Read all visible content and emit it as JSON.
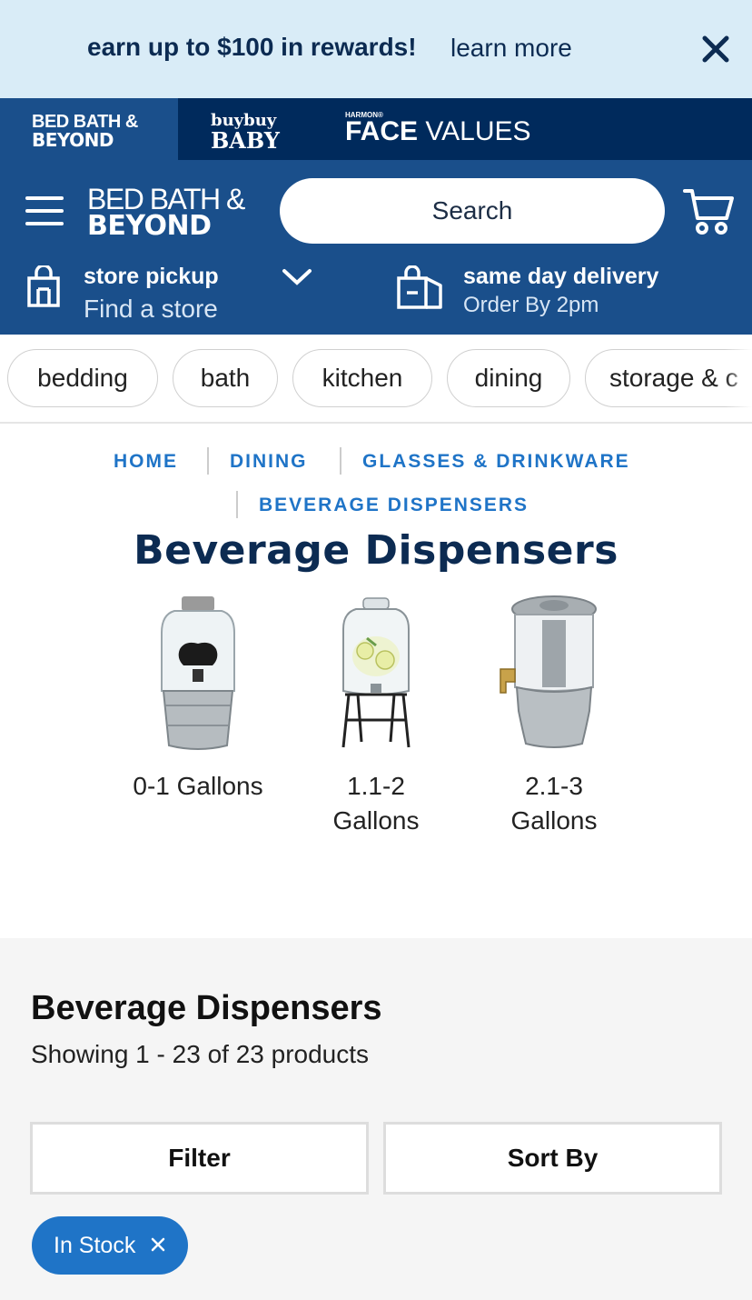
{
  "promo": {
    "text": "earn up to $100 in rewards!",
    "link": "learn more"
  },
  "brands": {
    "bbb_line1": "BED BATH &",
    "bbb_line2": "BEYOND",
    "buybuy_line1": "buybuy",
    "buybuy_line2": "BABY",
    "harmon": "HARMON®",
    "face": "FACE",
    "values": "VALUES"
  },
  "header": {
    "logo_line1": "BED BATH &",
    "logo_line2": "BEYOND",
    "search_placeholder": "Search",
    "pickup_title": "store pickup",
    "pickup_sub": "Find a store",
    "delivery_title": "same day delivery",
    "delivery_sub": "Order By 2pm"
  },
  "categories": [
    "bedding",
    "bath",
    "kitchen",
    "dining",
    "storage & c"
  ],
  "breadcrumb": [
    "HOME",
    "DINING",
    "GLASSES & DRINKWARE",
    "BEVERAGE DISPENSERS"
  ],
  "page_title": "Beverage Dispensers",
  "subcategories": [
    {
      "line1": "0-1 Gallons",
      "line2": ""
    },
    {
      "line1": "1.1-2",
      "line2": "Gallons"
    },
    {
      "line1": "2.1-3",
      "line2": "Gallons"
    }
  ],
  "listing": {
    "title": "Beverage Dispensers",
    "count": "Showing 1 - 23 of 23 products",
    "filter_label": "Filter",
    "sort_label": "Sort By",
    "active_filter": "In Stock"
  },
  "colors": {
    "promo_bg": "#d9ecf7",
    "brand_bar": "#002a5c",
    "header_blue": "#1a4f8b",
    "link_blue": "#1f74c7",
    "title_navy": "#0c2b52"
  }
}
